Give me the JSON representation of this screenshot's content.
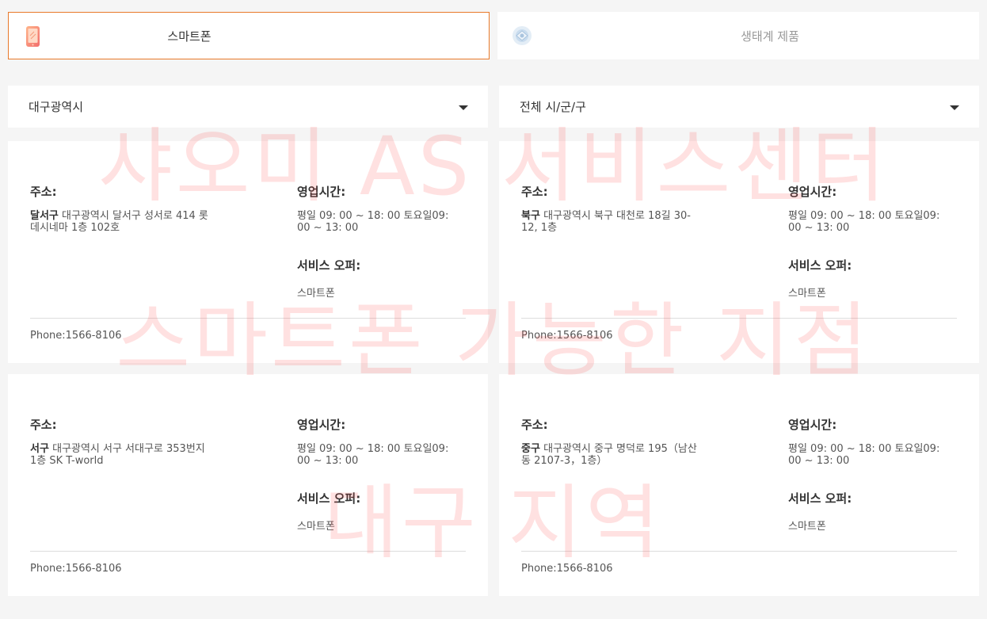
{
  "tabs": [
    {
      "label": "스마트폰",
      "icon": "smartphone-icon",
      "active": true
    },
    {
      "label": "생태계 제품",
      "icon": "ecosystem-icon",
      "active": false
    }
  ],
  "filters": {
    "city": "대구광역시",
    "district": "전체 시/군/구"
  },
  "labels": {
    "address": "주소:",
    "hours": "영업시간:",
    "offer": "서비스 오퍼:"
  },
  "stores": [
    {
      "district": "달서구",
      "address": "대구광역시 달서구 성서로 414 롯데시네마 1층 102호",
      "hours": "평일 09: 00 ~ 18: 00 토요일09: 00 ~ 13: 00",
      "offer": "스마트폰",
      "phone": "Phone:1566-8106"
    },
    {
      "district": "북구",
      "address": "대구광역시 북구 대천로 18길 30-12, 1층",
      "hours": "평일 09: 00 ~ 18: 00 토요일09: 00 ~ 13: 00",
      "offer": "스마트폰",
      "phone": "Phone:1566-8106"
    },
    {
      "district": "서구",
      "address": "대구광역시 서구 서대구로 353번지 1층 SK T-world",
      "hours": "평일 09: 00 ~ 18: 00 토요일09: 00 ~ 13: 00",
      "offer": "스마트폰",
      "phone": "Phone:1566-8106"
    },
    {
      "district": "중구",
      "address": "대구광역시 중구 명덕로 195（남산동 2107-3，1층）",
      "hours": "평일 09: 00 ~ 18: 00 토요일09: 00 ~ 13: 00",
      "offer": "스마트폰",
      "phone": "Phone:1566-8106"
    }
  ],
  "watermark": {
    "line1": "샤오미 AS 서비스센터",
    "line2": "스마트폰 가능한 지점",
    "line3": "대구 지역"
  },
  "colors": {
    "accent": "#e8792a",
    "background": "#f5f5f5",
    "watermark": "#ff4646"
  }
}
